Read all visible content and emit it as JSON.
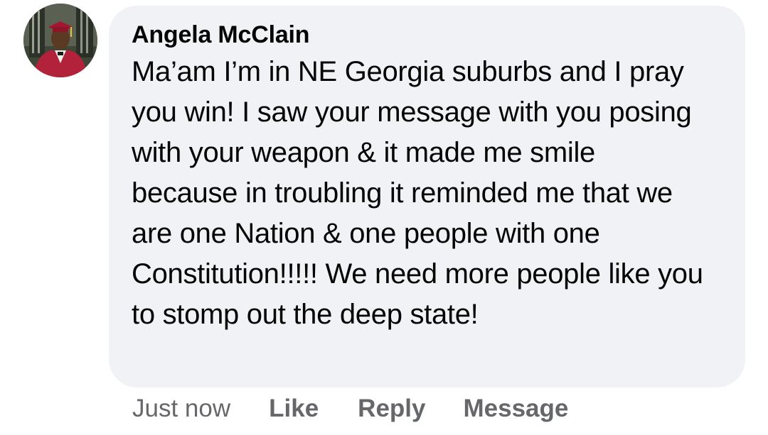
{
  "comment": {
    "author": "Angela McClain",
    "avatar": "profile-photo",
    "text": "Ma’am I’m in NE Georgia suburbs and I pray you win! I saw your message with you posing with your weapon & it made me smile because in troubling it reminded me that we are one Nation & one people with one Constitution!!!!! We need more people like you to stomp out the deep state!"
  },
  "actions": {
    "timestamp": "Just now",
    "like_label": "Like",
    "reply_label": "Reply",
    "message_label": "Message"
  },
  "colors": {
    "bubble_background": "#f0f2f5",
    "action_text": "#65676b",
    "body_text": "#050505"
  }
}
